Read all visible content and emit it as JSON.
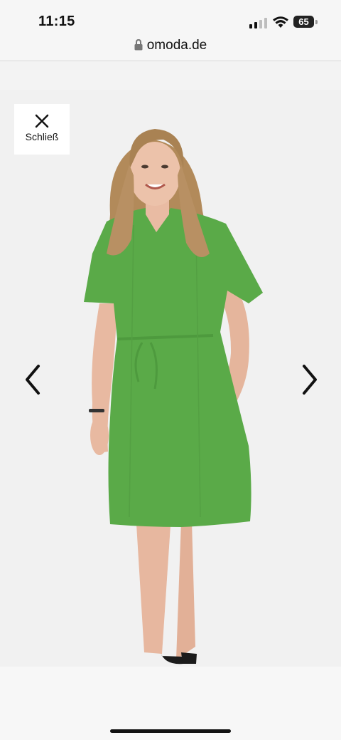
{
  "status_bar": {
    "time": "11:15",
    "battery_percent": "65",
    "signal_bars_active": 2,
    "signal_bars_total": 4
  },
  "browser": {
    "url": "omoda.de"
  },
  "lightbox": {
    "close_label": "Schließ",
    "close_icon": "close-icon",
    "prev_icon": "chevron-left-icon",
    "next_icon": "chevron-right-icon",
    "image_subject": "green-dress-product-photo"
  },
  "colors": {
    "dress": "#5aaa48",
    "background": "#f1f1f1"
  }
}
